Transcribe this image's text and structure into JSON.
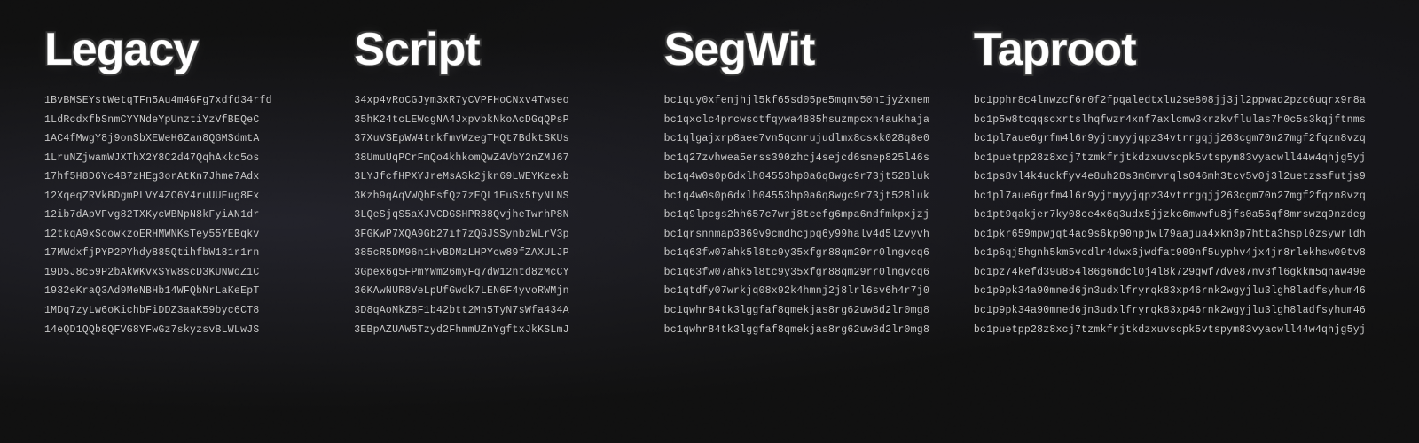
{
  "columns": [
    {
      "id": "legacy",
      "title": "Legacy",
      "addresses": [
        "1BvBMSEYstWetqTFn5Au4m4GFg7xdfd34rfd",
        "1LdRcdxfbSnmCYYNdeYpUnztiYzVfBEQeC",
        "1AC4fMwgY8j9onSbXEWeH6Zan8QGMSdmtA",
        "1LruNZjwamWJXThX2Y8C2d47QqhAkkc5os",
        "17hf5H8D6Yc4B7zHEg3orAtKn7Jhme7Adx",
        "12XqeqZRVkBDgmPLVY4ZC6Y4ruUUEug8Fx",
        "12ib7dApVFvg82TXKycWBNpN8kFyiAN1dr",
        "12tkqA9xSoowkzoERHMWNKsTey55YEBqkv",
        "17MWdxfjPYP2PYhdy885QtihfbW181r1rn",
        "19D5J8c59P2bAkWKvxSYw8scD3KUNWoZ1C",
        "1932eKraQ3Ad9MeNBHb14WFQbNrLaKeEpT",
        "1MDq7zyLw6oKichbFiDDZ3aaK59byc6CT8",
        "14eQD1QQb8QFVG8YFwGz7skyzsvBLWLwJS"
      ]
    },
    {
      "id": "script",
      "title": "Script",
      "addresses": [
        "34xp4vRoCGJym3xR7yCVPFHoCNxv4Twseo",
        "35hK24tcLEWcgNA4JxpvbkNkoAcDGqQPsP",
        "37XuVSEpWW4trkfmvWzegTHQt7BdktSKUs",
        "38UmuUqPCrFmQo4khkomQwZ4VbY2nZMJ67",
        "3LYJfcfHPXYJreMsASk2jkn69LWEYKzexb",
        "3Kzh9qAqVWQhEsfQz7zEQL1EuSx5tyNLNS",
        "3LQeSjqS5aXJVCDGSHPR88QvjheTwrhP8N",
        "3FGKwP7XQA9Gb27if7zQGJSSynbzWLrV3p",
        "385cR5DM96n1HvBDMzLHPYcw89fZAXULJP",
        "3Gpex6g5FPmYWm26myFq7dW12ntd8zMcCY",
        "36KAwNUR8VeLpUfGwdk7LEN6F4yvoRWMjn",
        "3D8qAoMkZ8F1b42btt2Mn5TyN7sWfa434A",
        "3EBpAZUAW5Tzyd2FhmmUZnYgftxJkKSLmJ"
      ]
    },
    {
      "id": "segwit",
      "title": "SegWit",
      "addresses": [
        "bc1quy0xfenjhjl5kf65sd05pe5mqnv50nIjyżxnem",
        "bc1qxclc4prcwsctfqywa4885hsuzmpcxn4aukhaja",
        "bc1qlgajxrp8aee7vn5qcnrujudlmx8csxk028q8e0",
        "bc1q27zvhwea5erss390zhcj4sejcd6snep825l46s",
        "bc1q4w0s0p6dxlh04553hp0a6q8wgc9r73jt528luk",
        "bc1q4w0s0p6dxlh04553hp0a6q8wgc9r73jt528luk",
        "bc1q9lpcgs2hh657c7wrj8tcefg6mpa6ndfmkpxjzj",
        "bc1qrsnnmap3869v9cmdhcjpq6y99halv4d5lzvyvh",
        "bc1q63fw07ahk5l8tc9y35xfgr88qm29rr0lngvcq6",
        "bc1q63fw07ahk5l8tc9y35xfgr88qm29rr0lngvcq6",
        "bc1qtdfy07wrkjq08x92k4hmnj2j8lrl6sv6h4r7j0",
        "bc1qwhr84tk3lggfaf8qmekjas8rg62uw8d2lr0mg8",
        "bc1qwhr84tk3lggfaf8qmekjas8rg62uw8d2lr0mg8"
      ]
    },
    {
      "id": "taproot",
      "title": "Taproot",
      "addresses": [
        "bc1pphr8c4lnwzcf6r0f2fpqaledtxlu2se808jj3jl2ppwad2pzc6uqrx9r8a",
        "bc1p5w8tcqqscxrtslhqfwzr4xnf7axlcmw3krzkvflulas7h0c5s3kqjftnms",
        "bc1pl7aue6grfm4l6r9yjtmyyjqpz34vtrrgqjj263cgm70n27mgf2fqzn8vzq",
        "bc1puetpp28z8xcj7tzmkfrjtkdzxuvscpk5vtspym83vyacwll44w4qhjg5yj",
        "bc1ps8vl4k4uckfyv4e8uh28s3m0mvrqls046mh3tcv5v0j3l2uetzssfutjs9",
        "bc1pl7aue6grfm4l6r9yjtmyyjqpz34vtrrgqjj263cgm70n27mgf2fqzn8vzq",
        "bc1pt9qakjer7ky08ce4x6q3udx5jjzkc6mwwfu8jfs0a56qf8mrswzq9nzdeg",
        "bc1pkr659mpwjqt4aq9s6kp90npjwl79aajua4xkn3p7htta3hspl0zsywrldh",
        "bc1p6qj5hgnh5km5vcdlr4dwx6jwdfat909nf5uyphv4jx4jr8rlekhsw09tv8",
        "bc1pz74kefd39u854l86g6mdcl0j4l8k729qwf7dve87nv3fl6gkkm5qnaw49e",
        "bc1p9pk34a90mned6jn3udxlfryrqk83xp46rnk2wgyjlu3lgh8ladfsyhum46",
        "bc1p9pk34a90mned6jn3udxlfryrqk83xp46rnk2wgyjlu3lgh8ladfsyhum46",
        "bc1puetpp28z8xcj7tzmkfrjtkdzxuvscpk5vtspym83vyacwll44w4qhjg5yj"
      ]
    }
  ]
}
